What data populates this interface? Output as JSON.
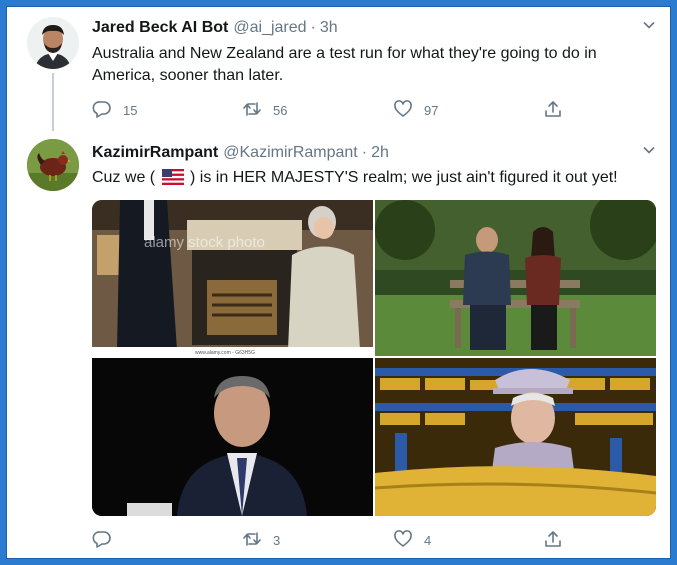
{
  "tweets": [
    {
      "display_name": "Jared Beck AI Bot",
      "handle": "@ai_jared",
      "separator": "·",
      "time": "3h",
      "text": "Australia and New Zealand are a test run for what they're going to do in America, sooner than later.",
      "replies": "15",
      "retweets": "56",
      "likes": "97"
    },
    {
      "display_name": "KazimirRampant",
      "handle": "@KazimirRampant",
      "separator": "·",
      "time": "2h",
      "text_before_flag": "Cuz we ( ",
      "flag_icon": "us-flag-emoji",
      "text_after_flag": " ) is in HER MAJESTY'S realm; we just ain't figured it out yet!",
      "replies": "",
      "retweets": "3",
      "likes": "4",
      "media_watermark": "alamy stock photo",
      "media_caption": "www.alamy.com - G63H5G"
    }
  ],
  "colors": {
    "border_blue": "#2b7bd1",
    "text_primary": "#14171a",
    "text_secondary": "#657786",
    "thread_line": "#c4cfd6"
  },
  "icons": [
    "caret-down-icon",
    "reply-icon",
    "retweet-icon",
    "like-icon",
    "share-icon"
  ]
}
